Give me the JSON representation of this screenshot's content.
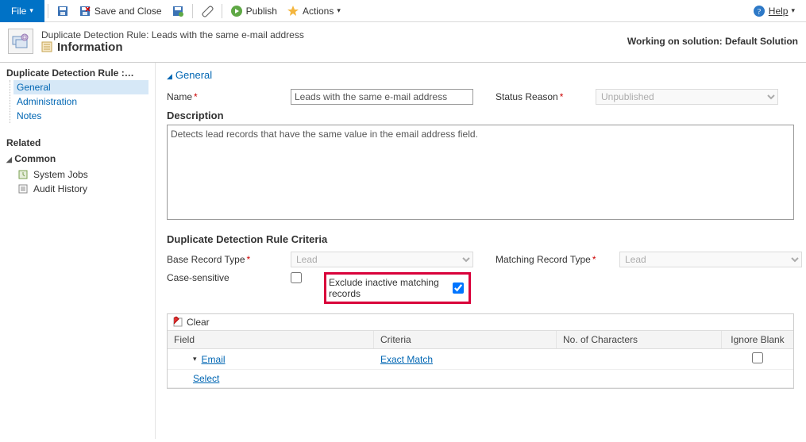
{
  "toolbar": {
    "file": "File",
    "save_close": "Save and Close",
    "publish": "Publish",
    "actions": "Actions",
    "help": "Help"
  },
  "header": {
    "breadcrumb": "Duplicate Detection Rule: Leads with the same e-mail address",
    "title": "Information",
    "solution": "Working on solution: Default Solution"
  },
  "leftnav": {
    "title": "Duplicate Detection Rule :…",
    "items": [
      "General",
      "Administration",
      "Notes"
    ],
    "related": "Related",
    "common": "Common",
    "common_items": [
      "System Jobs",
      "Audit History"
    ]
  },
  "section": {
    "general": "General",
    "name_label": "Name",
    "name_value": "Leads with the same e-mail address",
    "status_label": "Status Reason",
    "status_value": "Unpublished",
    "desc_label": "Description",
    "desc_value": "Detects lead records that have the same value in the email address field.",
    "criteria_header": "Duplicate Detection Rule Criteria",
    "base_label": "Base Record Type",
    "base_value": "Lead",
    "match_label": "Matching Record Type",
    "match_value": "Lead",
    "case_label": "Case-sensitive",
    "exclude_label": "Exclude inactive matching records"
  },
  "grid": {
    "clear": "Clear",
    "h_field": "Field",
    "h_criteria": "Criteria",
    "h_chars": "No. of Characters",
    "h_ignore": "Ignore Blank",
    "rows": [
      {
        "field": "Email",
        "criteria": "Exact Match"
      },
      {
        "field": "Select",
        "criteria": ""
      }
    ]
  }
}
